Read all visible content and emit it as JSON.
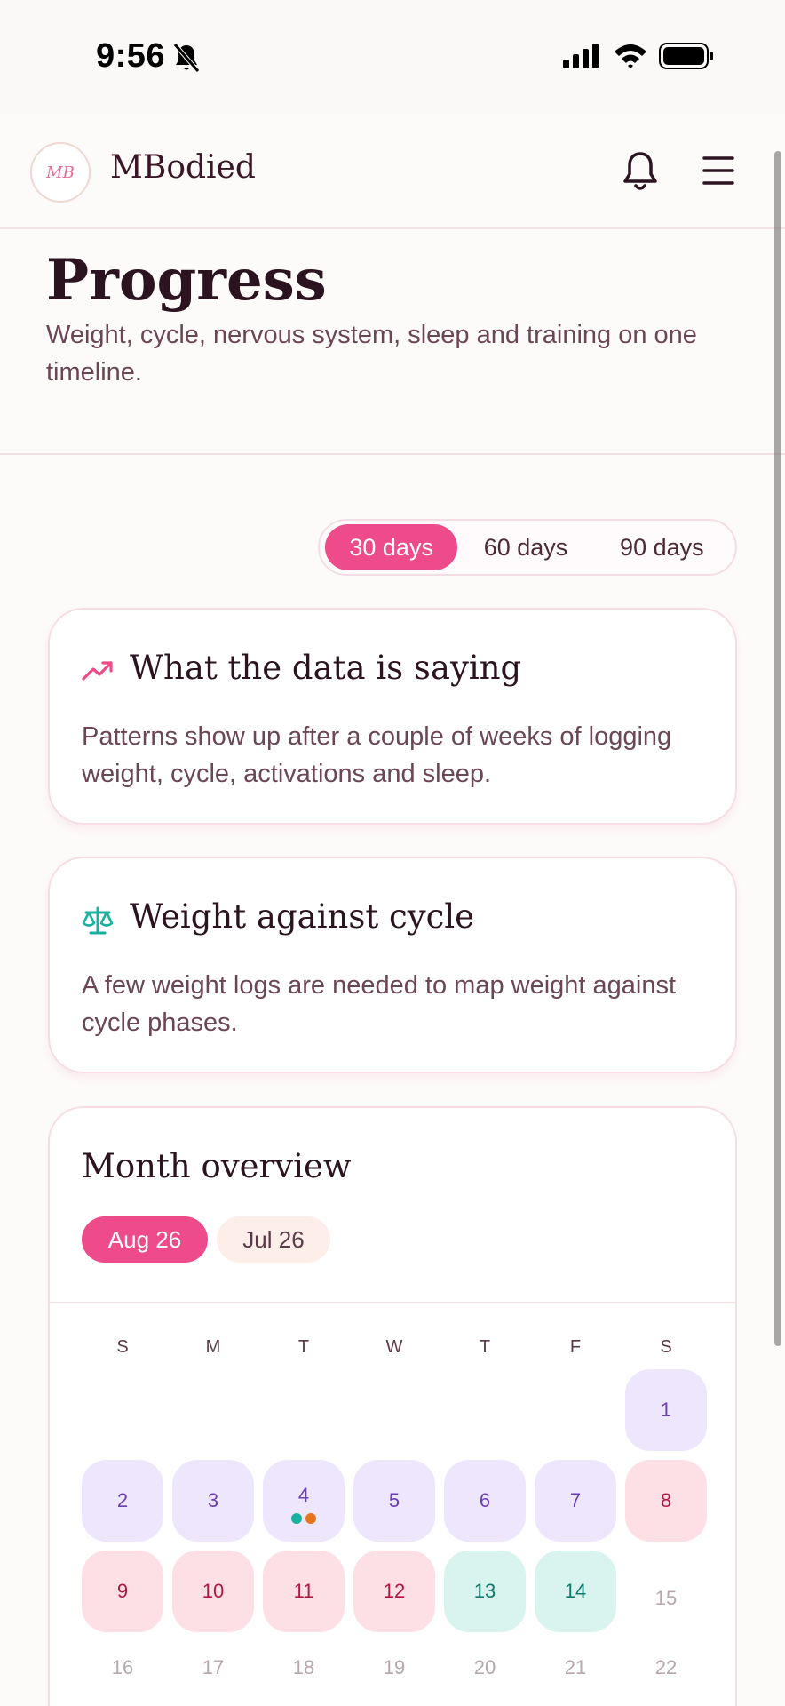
{
  "status_bar": {
    "time": "9:56",
    "mute_icon": "bell-slash-icon",
    "signal_icon": "cellular-signal-icon",
    "wifi_icon": "wifi-icon",
    "battery_icon": "battery-icon"
  },
  "header": {
    "logo_text": "MB",
    "brand": "MBodied",
    "notifications_icon": "bell-icon",
    "menu_icon": "hamburger-menu-icon"
  },
  "page": {
    "title": "Progress",
    "subtitle": "Weight, cycle, nervous system, sleep and training on one timeline."
  },
  "range_selector": {
    "options": [
      {
        "label": "30 days",
        "active": true
      },
      {
        "label": "60 days",
        "active": false
      },
      {
        "label": "90 days",
        "active": false
      }
    ]
  },
  "insight_card": {
    "icon": "trending-up-icon",
    "title": "What the data is saying",
    "body": "Patterns show up after a couple of weeks of logging weight, cycle, activations and sleep."
  },
  "weight_card": {
    "icon": "scale-icon",
    "title": "Weight against cycle",
    "body": "A few weight logs are needed to map weight against cycle phases."
  },
  "month_overview": {
    "title": "Month overview",
    "months": [
      {
        "label": "Aug 26",
        "active": true
      },
      {
        "label": "Jul 26",
        "active": false
      }
    ],
    "weekdays": [
      "S",
      "M",
      "T",
      "W",
      "T",
      "F",
      "S"
    ],
    "days": [
      {
        "day": "1",
        "phase": "purple"
      },
      {
        "day": "2",
        "phase": "purple"
      },
      {
        "day": "3",
        "phase": "purple"
      },
      {
        "day": "4",
        "phase": "purple"
      },
      {
        "day": "5",
        "phase": "purple"
      },
      {
        "day": "6",
        "phase": "purple"
      },
      {
        "day": "7",
        "phase": "purple"
      },
      {
        "day": "8",
        "phase": "pink"
      },
      {
        "day": "9",
        "phase": "pink"
      },
      {
        "day": "10",
        "phase": "pink"
      },
      {
        "day": "11",
        "phase": "pink"
      },
      {
        "day": "12",
        "phase": "pink"
      },
      {
        "day": "13",
        "phase": "teal"
      },
      {
        "day": "14",
        "phase": "teal"
      },
      {
        "day": "15",
        "phase": "none"
      },
      {
        "day": "16",
        "phase": "none"
      },
      {
        "day": "17",
        "phase": "none"
      },
      {
        "day": "18",
        "phase": "none"
      },
      {
        "day": "19",
        "phase": "none"
      },
      {
        "day": "20",
        "phase": "none"
      },
      {
        "day": "21",
        "phase": "none"
      },
      {
        "day": "22",
        "phase": "none"
      }
    ],
    "colors": {
      "accent": "#ee4b8a",
      "purple_bg": "#ede6fc",
      "pink_bg": "#fde0e6",
      "teal_bg": "#d9f3ee",
      "dot_teal": "#1ab09e",
      "dot_orange": "#e8731b"
    }
  }
}
